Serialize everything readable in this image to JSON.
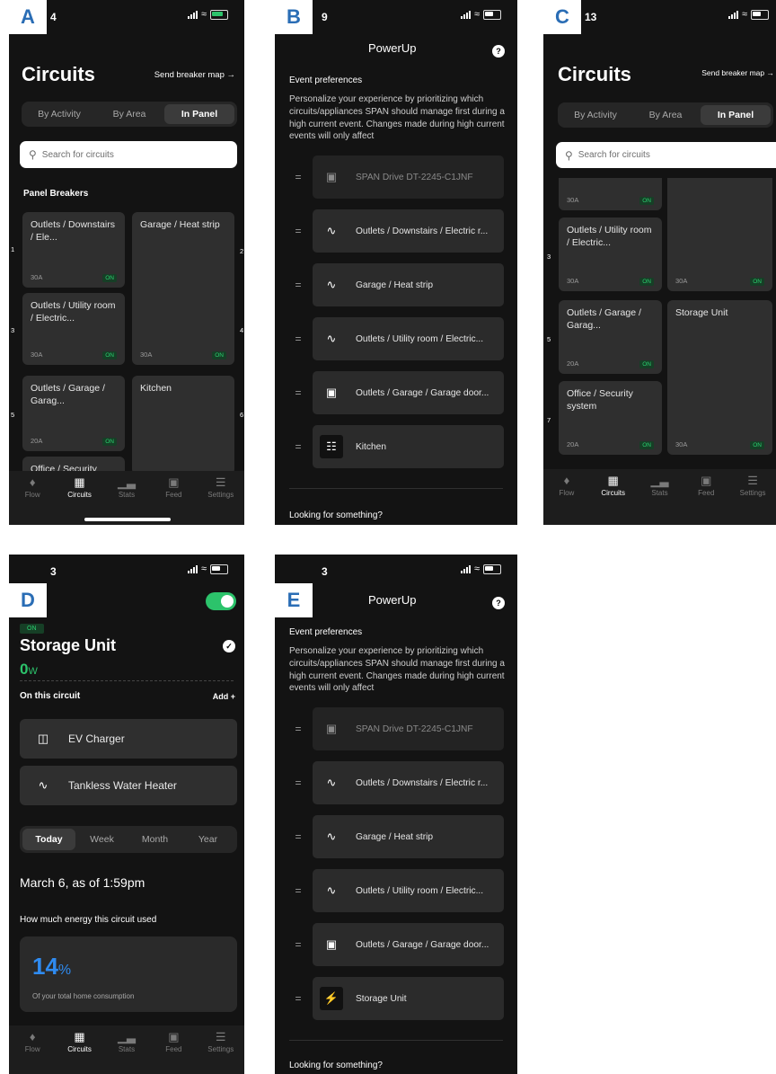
{
  "panels": {
    "A": {
      "label": "A",
      "time": "4",
      "title": "Circuits",
      "send_link": "Send breaker map →",
      "segments": [
        "By Activity",
        "By Area",
        "In Panel"
      ],
      "search_placeholder": "Search for circuits",
      "section": "Panel Breakers",
      "breakers": [
        {
          "slot": "1",
          "name": "Outlets / Downstairs / Ele...",
          "amp": "",
          "state": "ON"
        },
        {
          "slot": "2",
          "name": "Garage / Heat strip",
          "amp": "30A",
          "state": "ON"
        },
        {
          "slot": "3",
          "name": "Outlets / Utility room / Electric...",
          "amp": "30A",
          "state": "ON"
        },
        {
          "slot": "4",
          "name": "",
          "amp": "",
          "state": ""
        },
        {
          "slot": "5",
          "name": "Outlets / Garage / Garag...",
          "amp": "20A",
          "state": "ON"
        },
        {
          "slot": "6",
          "name": "Kitchen",
          "amp": "",
          "state": ""
        },
        {
          "slot": "",
          "name": "Office / Security",
          "amp": "",
          "state": ""
        }
      ],
      "first_amp": "30A"
    },
    "B": {
      "label": "B",
      "time": "9",
      "title": "PowerUp",
      "heading": "Event preferences",
      "paragraph": "Personalize your experience by prioritizing which circuits/appliances SPAN should manage first during a high current event. Changes made during high current events will only affect",
      "items": [
        {
          "icon": "ev-icon",
          "label": "SPAN Drive DT-2245-C1JNF",
          "dim": true
        },
        {
          "icon": "heat-icon",
          "label": "Outlets / Downstairs / Electric r..."
        },
        {
          "icon": "heat-icon",
          "label": "Garage / Heat strip"
        },
        {
          "icon": "heat-icon",
          "label": "Outlets / Utility room / Electric..."
        },
        {
          "icon": "ev-icon",
          "label": "Outlets / Garage / Garage door..."
        },
        {
          "icon": "stove-icon",
          "label": "Kitchen"
        }
      ],
      "footer": "Looking for something?"
    },
    "C": {
      "label": "C",
      "time": "13",
      "title": "Circuits",
      "send_link": "Send breaker map →",
      "segments": [
        "By Activity",
        "By Area",
        "In Panel"
      ],
      "search_placeholder": "Search for circuits",
      "top_amp": "30A",
      "top_state": "ON",
      "breakers": [
        {
          "slot": "3",
          "name": "Outlets / Utility room / Electric...",
          "amp": "30A",
          "state": "ON"
        },
        {
          "slot": "",
          "name": "",
          "amp": "30A",
          "state": "ON"
        },
        {
          "slot": "5",
          "name": "Outlets / Garage / Garag...",
          "amp": "20A",
          "state": "ON"
        },
        {
          "slot": "",
          "name": "Storage Unit",
          "amp": "30A",
          "state": "ON"
        },
        {
          "slot": "7",
          "name": "Office / Security system",
          "amp": "20A",
          "state": "ON"
        }
      ]
    },
    "D": {
      "label": "D",
      "time": "3",
      "state": "ON",
      "title": "Storage Unit",
      "watts_value": "0",
      "watts_unit": "W",
      "on_circuit": "On this circuit",
      "add": "Add +",
      "devices": [
        "EV Charger",
        "Tankless Water Heater"
      ],
      "ranges": [
        "Today",
        "Week",
        "Month",
        "Year"
      ],
      "date": "March 6, as of 1:59pm",
      "energy_q": "How much energy this circuit used",
      "pct_value": "14",
      "pct_unit": "%",
      "pct_caption": "Of your total home consumption"
    },
    "E": {
      "label": "E",
      "time": "3",
      "title": "PowerUp",
      "heading": "Event preferences",
      "paragraph": "Personalize your experience by prioritizing which circuits/appliances SPAN should manage first during a high current event. Changes made during high current events will only affect",
      "items": [
        {
          "icon": "ev-icon",
          "label": "SPAN Drive DT-2245-C1JNF",
          "dim": true
        },
        {
          "icon": "heat-icon",
          "label": "Outlets / Downstairs / Electric r..."
        },
        {
          "icon": "heat-icon",
          "label": "Garage / Heat strip"
        },
        {
          "icon": "heat-icon",
          "label": "Outlets / Utility room / Electric..."
        },
        {
          "icon": "ev-icon",
          "label": "Outlets / Garage / Garage door..."
        },
        {
          "icon": "bolt-icon",
          "label": "Storage Unit"
        }
      ],
      "footer": "Looking for something?"
    }
  },
  "tabbar": [
    "Flow",
    "Circuits",
    "Stats",
    "Feed",
    "Settings"
  ],
  "colors": {
    "accent_green": "#2cc36b",
    "accent_blue": "#2f8bf0",
    "label_blue": "#2a6db5",
    "bg": "#131313"
  }
}
